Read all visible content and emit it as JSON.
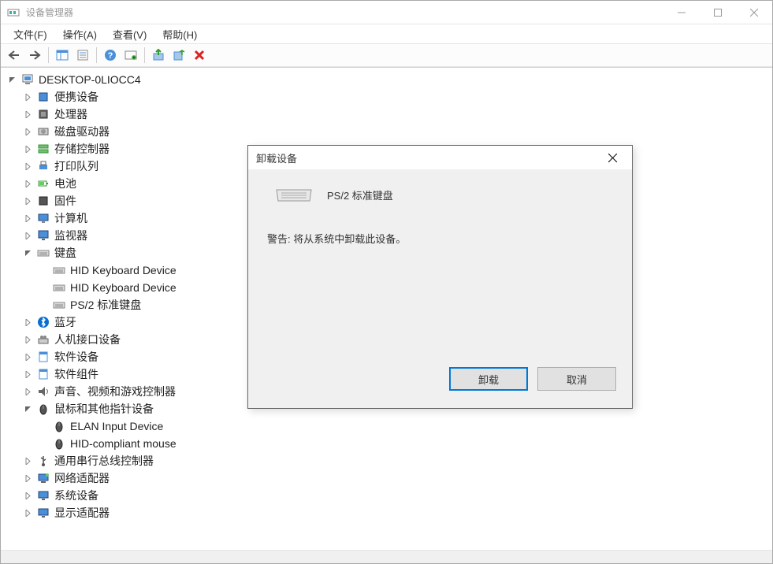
{
  "window": {
    "title": "设备管理器"
  },
  "menus": {
    "file": "文件(F)",
    "action": "操作(A)",
    "view": "查看(V)",
    "help": "帮助(H)"
  },
  "tree": {
    "root": "DESKTOP-0LIOCC4",
    "nodes": [
      {
        "label": "便携设备",
        "expanded": false,
        "icon": "portable"
      },
      {
        "label": "处理器",
        "expanded": false,
        "icon": "cpu"
      },
      {
        "label": "磁盘驱动器",
        "expanded": false,
        "icon": "disk"
      },
      {
        "label": "存储控制器",
        "expanded": false,
        "icon": "storage"
      },
      {
        "label": "打印队列",
        "expanded": false,
        "icon": "printer"
      },
      {
        "label": "电池",
        "expanded": false,
        "icon": "battery"
      },
      {
        "label": "固件",
        "expanded": false,
        "icon": "firmware"
      },
      {
        "label": "计算机",
        "expanded": false,
        "icon": "computer"
      },
      {
        "label": "监视器",
        "expanded": false,
        "icon": "monitor"
      },
      {
        "label": "键盘",
        "expanded": true,
        "icon": "keyboard",
        "children": [
          {
            "label": "HID Keyboard Device",
            "icon": "keyboard"
          },
          {
            "label": "HID Keyboard Device",
            "icon": "keyboard"
          },
          {
            "label": "PS/2 标准键盘",
            "icon": "keyboard"
          }
        ]
      },
      {
        "label": "蓝牙",
        "expanded": false,
        "icon": "bluetooth"
      },
      {
        "label": "人机接口设备",
        "expanded": false,
        "icon": "hid"
      },
      {
        "label": "软件设备",
        "expanded": false,
        "icon": "software"
      },
      {
        "label": "软件组件",
        "expanded": false,
        "icon": "software"
      },
      {
        "label": "声音、视频和游戏控制器",
        "expanded": false,
        "icon": "audio"
      },
      {
        "label": "鼠标和其他指针设备",
        "expanded": true,
        "icon": "mouse",
        "children": [
          {
            "label": "ELAN Input Device",
            "icon": "mouse"
          },
          {
            "label": "HID-compliant mouse",
            "icon": "mouse"
          }
        ]
      },
      {
        "label": "通用串行总线控制器",
        "expanded": false,
        "icon": "usb"
      },
      {
        "label": "网络适配器",
        "expanded": false,
        "icon": "network"
      },
      {
        "label": "系统设备",
        "expanded": false,
        "icon": "system"
      },
      {
        "label": "显示适配器",
        "expanded": false,
        "icon": "display"
      }
    ]
  },
  "dialog": {
    "title": "卸载设备",
    "device_name": "PS/2 标准键盘",
    "warning": "警告: 将从系统中卸载此设备。",
    "btn_uninstall": "卸载",
    "btn_cancel": "取消"
  }
}
